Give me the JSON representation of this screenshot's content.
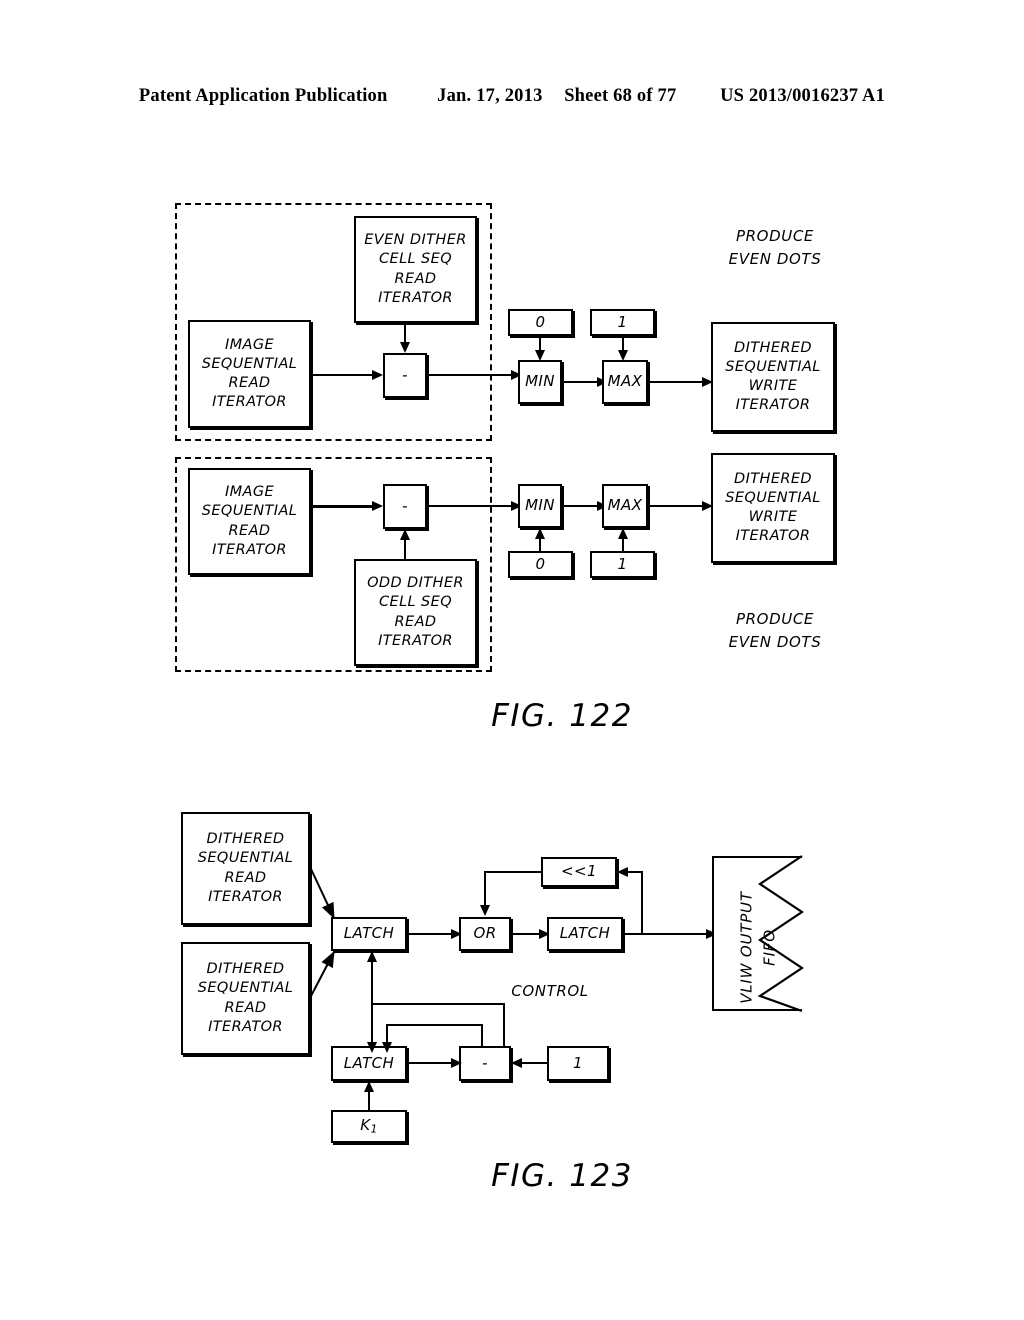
{
  "header": {
    "publication": "Patent Application Publication",
    "date": "Jan. 17, 2013",
    "sheet": "Sheet 68 of 77",
    "doc_number": "US 2013/0016237 A1"
  },
  "fig122": {
    "label": "FIG. 122",
    "group_even": {
      "image_read": [
        "IMAGE",
        "SEQUENTIAL",
        "READ",
        "ITERATOR"
      ],
      "dither_read": [
        "EVEN DITHER",
        "CELL SEQ",
        "READ",
        "ITERATOR"
      ],
      "subtract": "-"
    },
    "group_odd": {
      "image_read": [
        "IMAGE",
        "SEQUENTIAL",
        "READ",
        "ITERATOR"
      ],
      "dither_read": [
        "ODD DITHER",
        "CELL SEQ",
        "READ",
        "ITERATOR"
      ],
      "subtract": "-"
    },
    "top_chain": {
      "const_zero": "0",
      "const_one": "1",
      "min": "MIN",
      "max": "MAX",
      "write_iterator": [
        "DITHERED",
        "SEQUENTIAL",
        "WRITE",
        "ITERATOR"
      ]
    },
    "bottom_chain": {
      "const_zero": "0",
      "const_one": "1",
      "min": "MIN",
      "max": "MAX",
      "write_iterator": [
        "DITHERED",
        "SEQUENTIAL",
        "WRITE",
        "ITERATOR"
      ]
    },
    "annotation_top": [
      "PRODUCE",
      "EVEN DOTS"
    ],
    "annotation_bottom": [
      "PRODUCE",
      "EVEN DOTS"
    ]
  },
  "fig123": {
    "label": "FIG. 123",
    "read_iterator_1": [
      "DITHERED",
      "SEQUENTIAL",
      "READ",
      "ITERATOR"
    ],
    "read_iterator_2": [
      "DITHERED",
      "SEQUENTIAL",
      "READ",
      "ITERATOR"
    ],
    "latch_main": "LATCH",
    "or_gate": "OR",
    "shift_left": "<<1",
    "latch_out": "LATCH",
    "latch_counter": "LATCH",
    "subtract": "-",
    "const_one": "1",
    "const_k": "K",
    "const_k_sub": "1",
    "control_label": "CONTROL",
    "fifo_label": [
      "VLIW OUTPUT",
      "FIFO"
    ]
  },
  "colors": {
    "ink": "#000000",
    "paper": "#ffffff"
  }
}
